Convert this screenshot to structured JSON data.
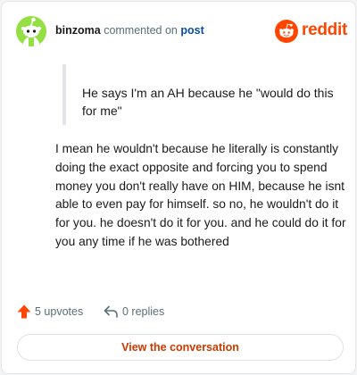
{
  "header": {
    "username": "binzoma",
    "action_text": "commented on",
    "target_text": "post",
    "brand_name": "reddit",
    "avatar_icon": "snoo-avatar-icon",
    "brand_icon": "reddit-logo-icon"
  },
  "comment": {
    "quote": "He says I'm an AH because he \"would do this for me\"",
    "body": "I mean he wouldn't because he literally is constantly doing the exact opposite and forcing you to spend money you don't really have on HIM, because he isnt able to even pay for himself. so no, he wouldn't do it for you. he doesn't do it for you. and he could do it for you any time if he was bothered"
  },
  "footer": {
    "upvotes_label": "5 upvotes",
    "replies_label": "0 replies",
    "upvote_icon": "upvote-arrow-icon",
    "reply_icon": "reply-icon"
  },
  "cta": {
    "label": "View the conversation"
  },
  "colors": {
    "brand": "#ff4500",
    "avatar_bg": "#94e044",
    "link": "#0a4d9c",
    "cta_text": "#c83a00",
    "muted": "#576f76"
  }
}
